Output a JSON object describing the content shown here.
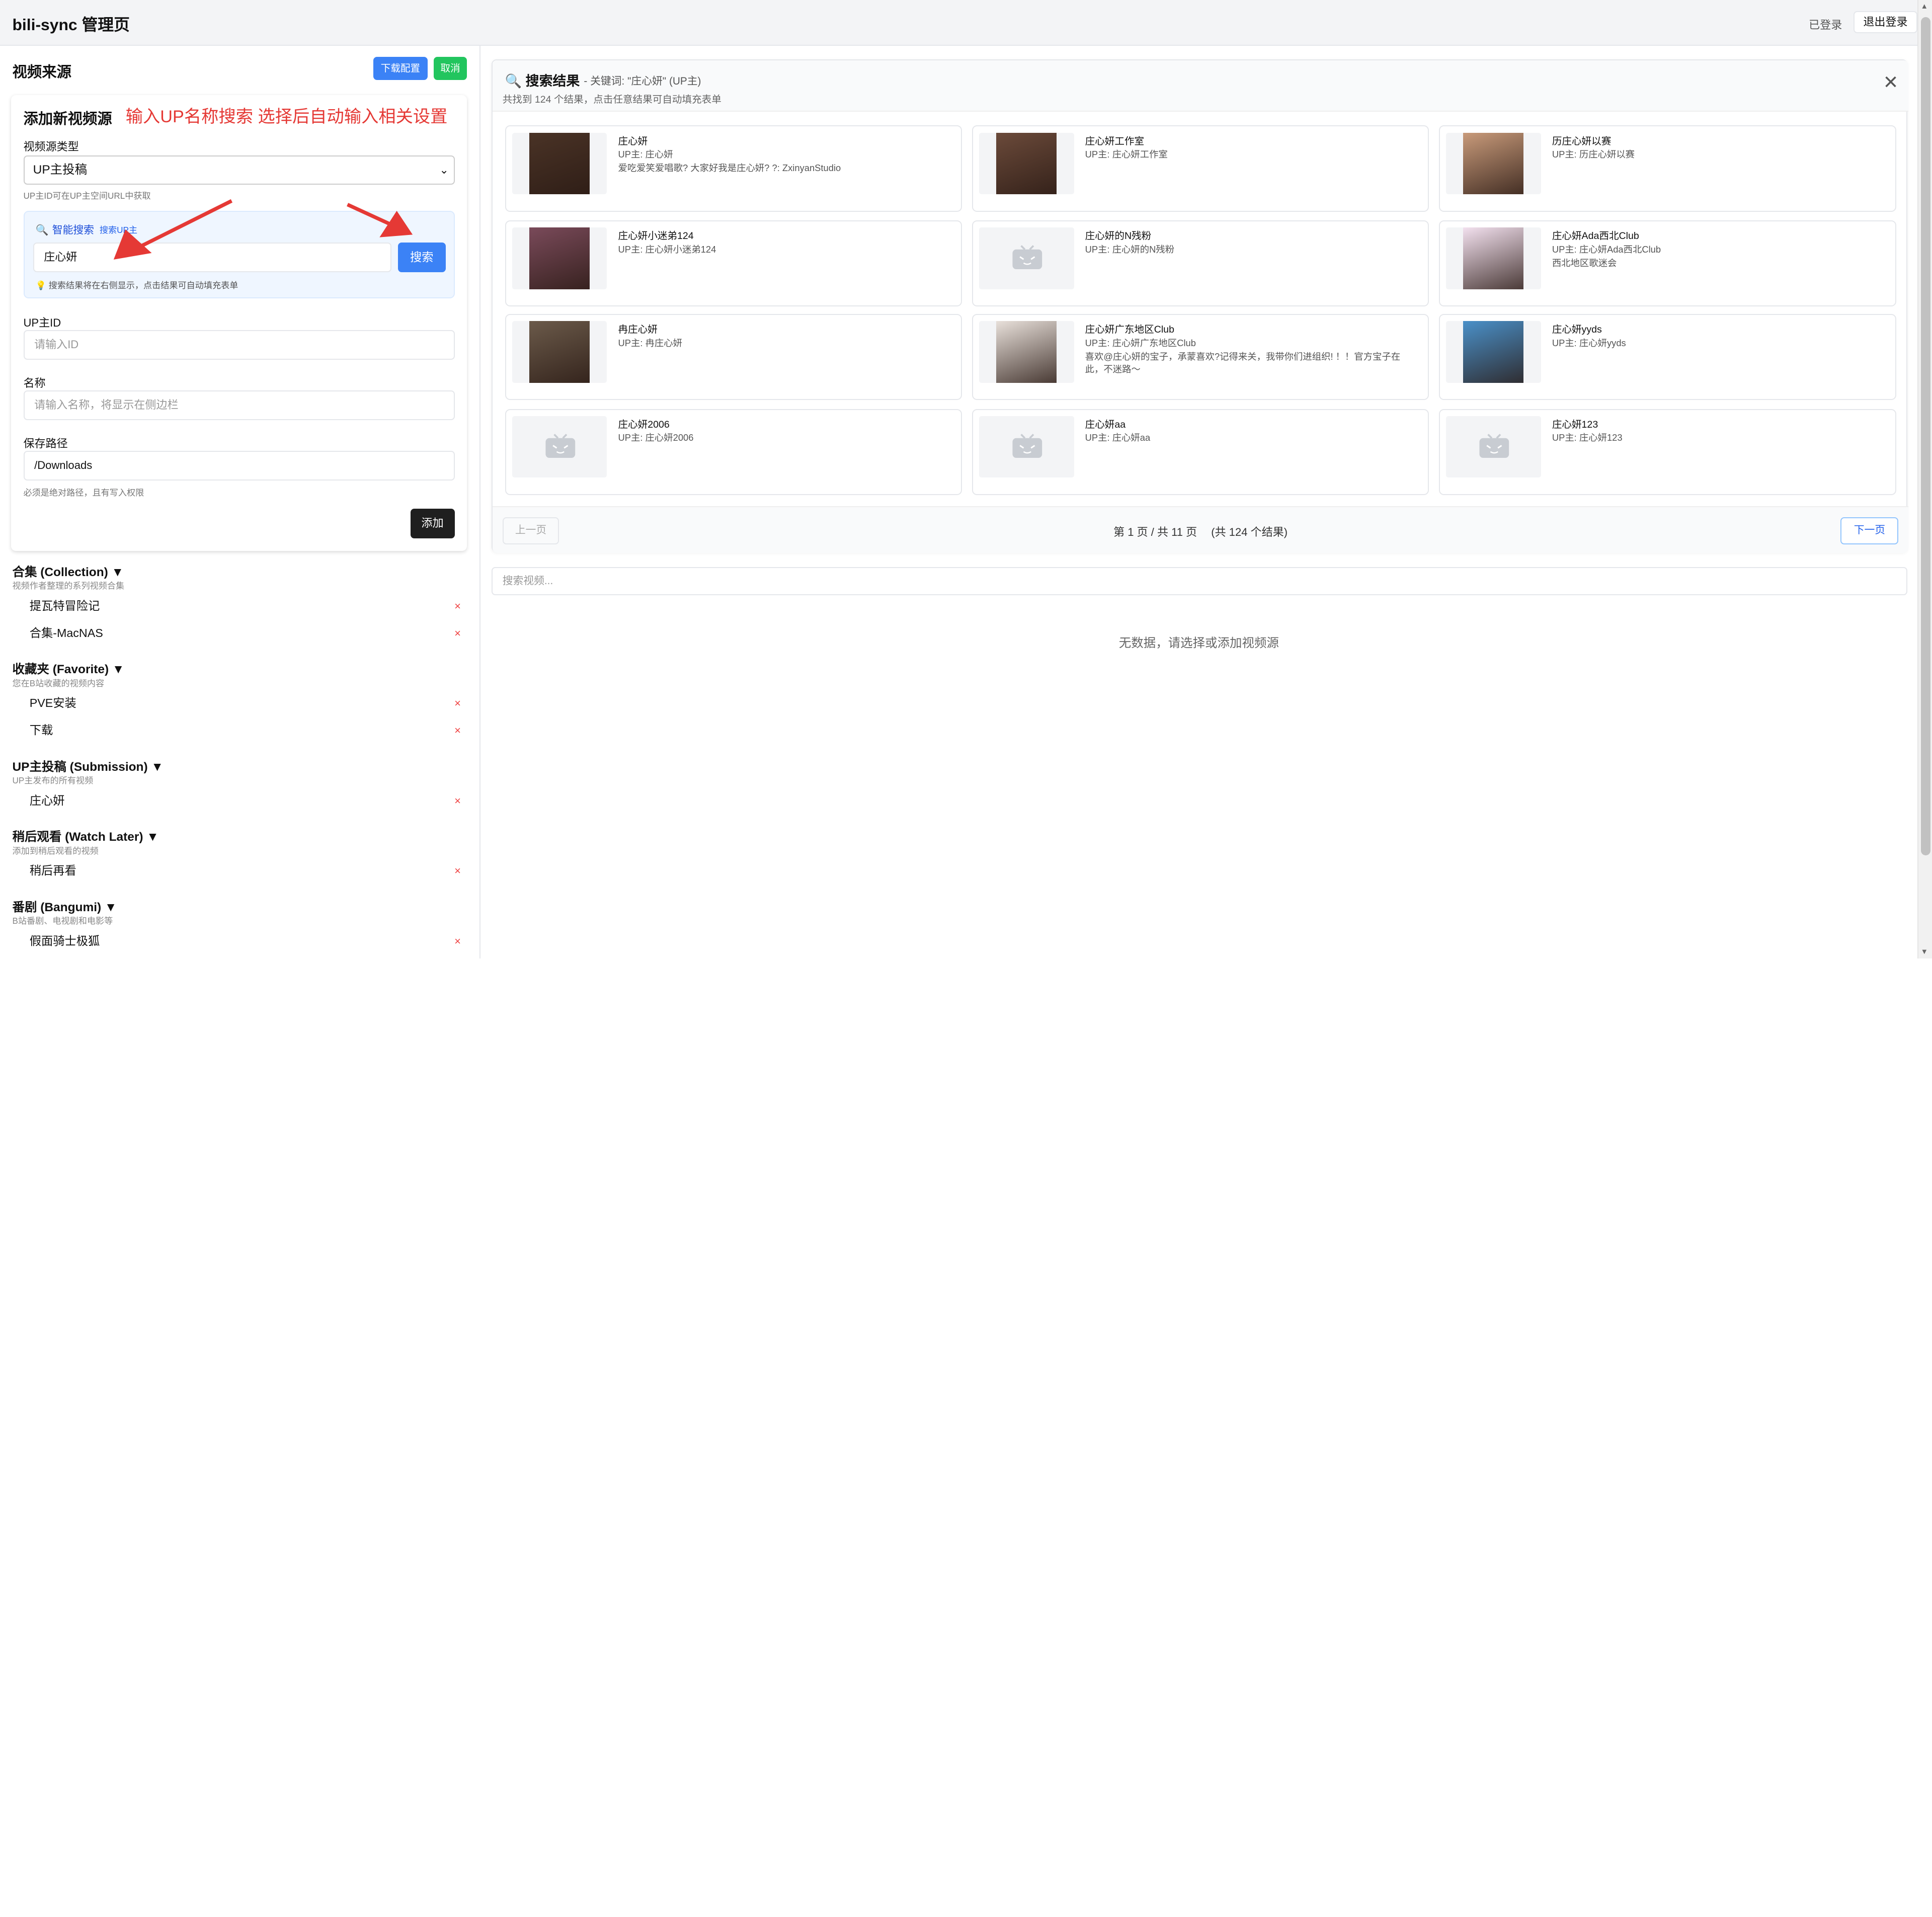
{
  "header": {
    "title": "bili-sync 管理页",
    "status": "已登录",
    "logout_label": "退出登录"
  },
  "sidebar": {
    "title": "视频来源",
    "download_config_label": "下载配置",
    "cancel_label": "取消",
    "form": {
      "title": "添加新视频源",
      "annotation": "输入UP名称搜索 选择后自动输入相关设置",
      "source_type_label": "视频源类型",
      "source_type_value": "UP主投稿",
      "source_type_help": "UP主ID可在UP主空间URL中获取",
      "smart_search": {
        "icon": "search-icon",
        "title": "智能搜索",
        "subtitle": "搜索UP主",
        "input_value": "庄心妍",
        "button_label": "搜索",
        "tip": "💡 搜索结果将在右侧显示，点击结果可自动填充表单"
      },
      "up_id_label": "UP主ID",
      "up_id_placeholder": "请输入ID",
      "name_label": "名称",
      "name_placeholder": "请输入名称，将显示在侧边栏",
      "path_label": "保存路径",
      "path_value": "/Downloads",
      "path_help": "必须是绝对路径，且有写入权限",
      "add_label": "添加"
    },
    "groups": [
      {
        "title": "合集 (Collection) ▼",
        "desc": "视频作者整理的系列视频合集",
        "items": [
          "提瓦特冒险记",
          "合集-MacNAS"
        ]
      },
      {
        "title": "收藏夹 (Favorite) ▼",
        "desc": "您在B站收藏的视频内容",
        "items": [
          "PVE安装",
          "下载"
        ]
      },
      {
        "title": "UP主投稿 (Submission) ▼",
        "desc": "UP主发布的所有视频",
        "items": [
          "庄心妍"
        ]
      },
      {
        "title": "稍后观看 (Watch Later) ▼",
        "desc": "添加到稍后观看的视频",
        "items": [
          "稍后再看"
        ]
      },
      {
        "title": "番剧 (Bangumi) ▼",
        "desc": "B站番剧、电视剧和电影等",
        "items": [
          "假面骑士极狐"
        ]
      }
    ],
    "delete_glyph": "×"
  },
  "results": {
    "icon": "search-icon",
    "title": "搜索结果",
    "keyword_text": "- 关键词: \"庄心妍\" (UP主)",
    "count_text": "共找到 124 个结果，点击任意结果可自动填充表单",
    "close_glyph": "✕",
    "items": [
      {
        "name": "庄心妍",
        "up": "UP主: 庄心妍",
        "desc": "爱吃爱笑爱唱歌? 大家好我是庄心妍? ?: ZxinyanStudio",
        "thumb": "photo",
        "color": "#4a3326"
      },
      {
        "name": "庄心妍工作室",
        "up": "UP主: 庄心妍工作室",
        "desc": "",
        "thumb": "photo",
        "color": "#6b4a3a"
      },
      {
        "name": "历庄心妍以赛",
        "up": "UP主: 历庄心妍以赛",
        "desc": "",
        "thumb": "photo",
        "color": "#c89a7a"
      },
      {
        "name": "庄心妍小迷弟124",
        "up": "UP主: 庄心妍小迷弟124",
        "desc": "",
        "thumb": "photo",
        "color": "#7a4a5a"
      },
      {
        "name": "庄心妍的N残粉",
        "up": "UP主: 庄心妍的N残粉",
        "desc": "",
        "thumb": "placeholder",
        "color": ""
      },
      {
        "name": "庄心妍Ada西北Club",
        "up": "UP主: 庄心妍Ada西北Club",
        "desc": "西北地区歌迷会",
        "thumb": "photo",
        "color": "#f3e1ef"
      },
      {
        "name": "冉庄心妍",
        "up": "UP主: 冉庄心妍",
        "desc": "",
        "thumb": "photo",
        "color": "#6b5a4a"
      },
      {
        "name": "庄心妍广东地区Club",
        "up": "UP主: 庄心妍广东地区Club",
        "desc": "喜欢@庄心妍的宝子，承蒙喜欢?记得来关，我带你们进组织! ！！官方宝子在此，不迷路～",
        "thumb": "photo",
        "color": "#e8e0da"
      },
      {
        "name": "庄心妍yyds",
        "up": "UP主: 庄心妍yyds",
        "desc": "",
        "thumb": "photo",
        "color": "#4a90c8"
      },
      {
        "name": "庄心妍2006",
        "up": "UP主: 庄心妍2006",
        "desc": "",
        "thumb": "placeholder",
        "color": ""
      },
      {
        "name": "庄心妍aa",
        "up": "UP主: 庄心妍aa",
        "desc": "",
        "thumb": "placeholder",
        "color": ""
      },
      {
        "name": "庄心妍123",
        "up": "UP主: 庄心妍123",
        "desc": "",
        "thumb": "placeholder",
        "color": ""
      }
    ],
    "pagination": {
      "prev_label": "上一页",
      "info": "第 1 页 / 共 11 页　 (共 124 个结果)",
      "next_label": "下一页"
    }
  },
  "video_search": {
    "placeholder": "搜索视频..."
  },
  "empty_text": "无数据，请选择或添加视频源",
  "colors": {
    "accent": "#3b82f6",
    "success": "#22c55e",
    "danger": "#ef4444",
    "annotation": "#e53935"
  }
}
